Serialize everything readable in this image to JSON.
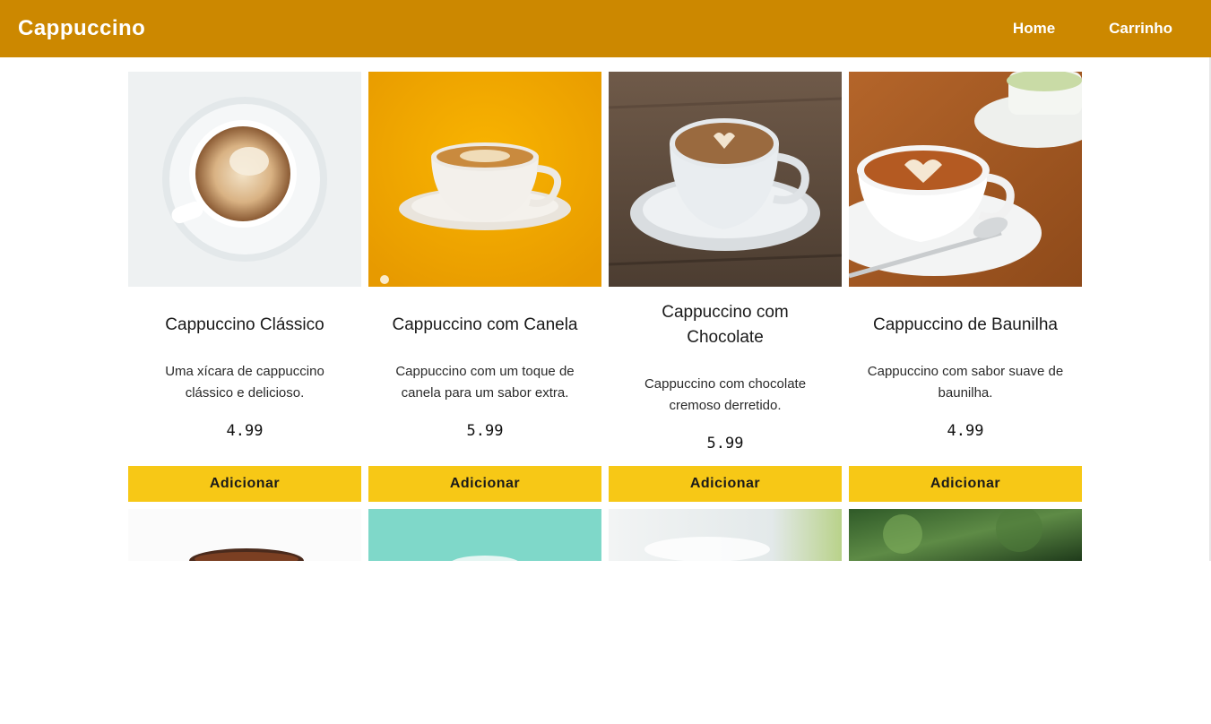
{
  "header": {
    "brand": "Cappuccino",
    "nav": [
      {
        "label": "Home"
      },
      {
        "label": "Carrinho"
      }
    ]
  },
  "products": [
    {
      "title": "Cappuccino Clássico",
      "description": "Uma xícara de cappuccino clássico e delicioso.",
      "price": "4.99",
      "button": "Adicionar",
      "image": "coffee-cup-top-view-image"
    },
    {
      "title": "Cappuccino com Canela",
      "description": "Cappuccino com um toque de canela para um sabor extra.",
      "price": "5.99",
      "button": "Adicionar",
      "image": "coffee-cup-orange-background-image"
    },
    {
      "title": "Cappuccino com Chocolate",
      "description": "Cappuccino com chocolate cremoso derretido.",
      "price": "5.99",
      "button": "Adicionar",
      "image": "coffee-cup-wood-table-image"
    },
    {
      "title": "Cappuccino de Baunilha",
      "description": "Cappuccino com sabor suave de baunilha.",
      "price": "4.99",
      "button": "Adicionar",
      "image": "coffee-cup-latte-art-image"
    }
  ],
  "colors": {
    "header": "#cc8800",
    "button": "#f7c816"
  }
}
